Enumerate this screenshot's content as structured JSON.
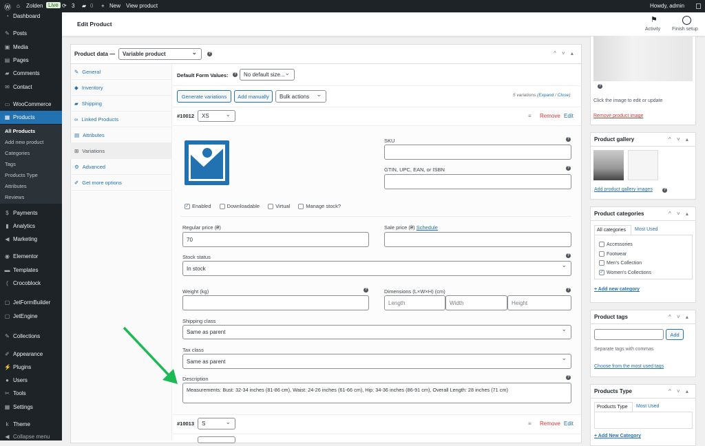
{
  "adminbar": {
    "site": "Zolden",
    "live": "Live",
    "updates": "3",
    "comments": "0",
    "new": "New",
    "view": "View product",
    "howdy": "Howdy, admin"
  },
  "sidebar": {
    "items": [
      {
        "label": "Dashboard",
        "icon": "dashboard-icon",
        "glyph": "◔"
      },
      {
        "label": "Posts",
        "icon": "pin-icon",
        "glyph": "✎"
      },
      {
        "label": "Media",
        "icon": "media-icon",
        "glyph": "▣"
      },
      {
        "label": "Pages",
        "icon": "pages-icon",
        "glyph": "▤"
      },
      {
        "label": "Comments",
        "icon": "comment-icon",
        "glyph": "▰"
      },
      {
        "label": "Contact",
        "icon": "mail-icon",
        "glyph": "✉"
      },
      {
        "label": "WooCommerce",
        "icon": "woo-icon",
        "glyph": "▭"
      },
      {
        "label": "Products",
        "icon": "products-icon",
        "glyph": "▦"
      },
      {
        "label": "Payments",
        "icon": "payments-icon",
        "glyph": "$"
      },
      {
        "label": "Analytics",
        "icon": "analytics-icon",
        "glyph": "▮"
      },
      {
        "label": "Marketing",
        "icon": "megaphone-icon",
        "glyph": "◀"
      },
      {
        "label": "Elementor",
        "icon": "elementor-icon",
        "glyph": "◉"
      },
      {
        "label": "Templates",
        "icon": "folder-icon",
        "glyph": "▬"
      },
      {
        "label": "Crocoblock",
        "icon": "crocoblock-icon",
        "glyph": "("
      },
      {
        "label": "JetFormBuilder",
        "icon": "jet-icon",
        "glyph": "▢"
      },
      {
        "label": "JetEngine",
        "icon": "jet-icon",
        "glyph": "▢"
      },
      {
        "label": "Collections",
        "icon": "pin-icon",
        "glyph": "✎"
      },
      {
        "label": "Appearance",
        "icon": "brush-icon",
        "glyph": "✐"
      },
      {
        "label": "Plugins",
        "icon": "plugin-icon",
        "glyph": "⚡"
      },
      {
        "label": "Users",
        "icon": "users-icon",
        "glyph": "●"
      },
      {
        "label": "Tools",
        "icon": "wrench-icon",
        "glyph": "✂"
      },
      {
        "label": "Settings",
        "icon": "settings-icon",
        "glyph": "▦"
      },
      {
        "label": "Theme",
        "icon": "kava-icon",
        "glyph": "k"
      },
      {
        "label": "Collapse menu",
        "icon": "collapse-icon",
        "glyph": "◀"
      }
    ],
    "submenu": [
      "All Products",
      "Add new product",
      "Categories",
      "Tags",
      "Products Type",
      "Attributes",
      "Reviews"
    ]
  },
  "header": {
    "title": "Edit Product",
    "activity": "Activity",
    "finish": "Finish setup"
  },
  "productdata": {
    "label": "Product data —",
    "type": "Variable product",
    "tabs": [
      {
        "label": "General",
        "glyph": "✎"
      },
      {
        "label": "Inventory",
        "glyph": "◆"
      },
      {
        "label": "Shipping",
        "glyph": "▰"
      },
      {
        "label": "Linked Products",
        "glyph": "∞"
      },
      {
        "label": "Attributes",
        "glyph": "▤"
      },
      {
        "label": "Variations",
        "glyph": "⊞"
      },
      {
        "label": "Advanced",
        "glyph": "⚙"
      },
      {
        "label": "Get more options",
        "glyph": "✐"
      }
    ]
  },
  "variations": {
    "default_label": "Default Form Values:",
    "default_value": "No default size...",
    "generate": "Generate variations",
    "add": "Add manually",
    "bulk": "Bulk actions",
    "count": "5 variations",
    "expand": "Expand",
    "close": "Close",
    "remove": "Remove",
    "edit": "Edit",
    "v1": {
      "id": "#10012",
      "size": "XS",
      "sku": "SKU",
      "gtin": "GTIN, UPC, EAN, or ISBN",
      "enabled": "Enabled",
      "downloadable": "Downloadable",
      "virtual": "Virtual",
      "manage": "Manage stock?",
      "regular_label": "Regular price (₴)",
      "regular": "70",
      "sale_label": "Sale price (₴)",
      "schedule": "Schedule",
      "stock_label": "Stock status",
      "stock": "In stock",
      "weight_label": "Weight (kg)",
      "dim_label": "Dimensions (L×W×H) (cm)",
      "length": "Length",
      "width": "Width",
      "height": "Height",
      "ship_label": "Shipping class",
      "ship": "Same as parent",
      "tax_label": "Tax class",
      "tax": "Same as parent",
      "desc_label": "Description",
      "desc": "Measurements: Bust: 32-34 inches (81-86 cm), Waist: 24-26 inches (61-66 cm), Hip: 34-36 inches (86-91 cm), Overall Length: 28 inches (71 cm)"
    },
    "v2": {
      "id": "#10013",
      "size": "S"
    }
  },
  "right": {
    "click_edit": "Click the image to edit or update",
    "remove_image": "Remove product image",
    "gallery": {
      "title": "Product gallery",
      "add": "Add product gallery images"
    },
    "categories": {
      "title": "Product categories",
      "tab_all": "All categories",
      "tab_most": "Most Used",
      "items": [
        {
          "label": "Accessories",
          "checked": false
        },
        {
          "label": "Footwear",
          "checked": false
        },
        {
          "label": "Men's Collection",
          "checked": false
        },
        {
          "label": "Women's Collections",
          "checked": true
        }
      ],
      "add": "+ Add new category"
    },
    "tags": {
      "title": "Product tags",
      "add": "Add",
      "hint": "Separate tags with commas",
      "choose": "Choose from the most used tags"
    },
    "ptype": {
      "title": "Products Type",
      "tab": "Products Type",
      "most": "Most Used",
      "add": "+ Add New Category"
    }
  },
  "colors": {
    "accent": "#2271b1",
    "sidebar": "#1d2327",
    "remove": "#d63638",
    "arrow": "#1db954"
  }
}
